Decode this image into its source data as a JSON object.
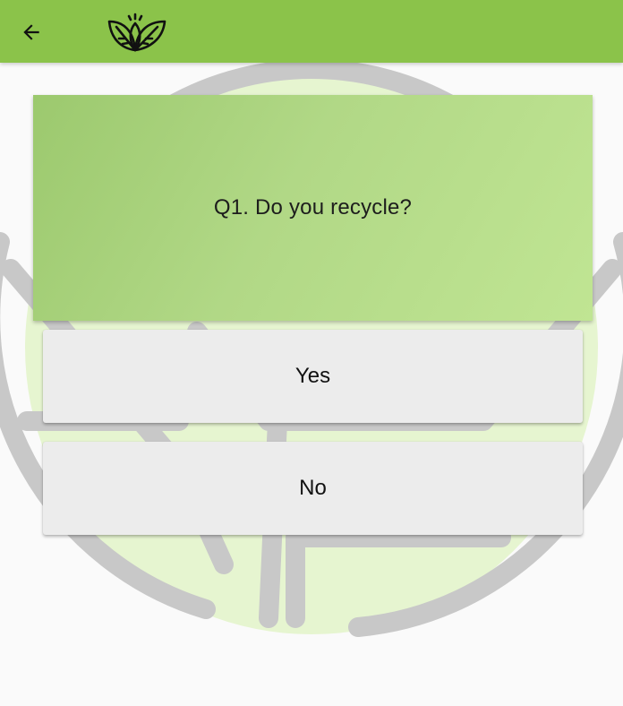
{
  "toolbar": {
    "back_icon": "arrow-left-icon",
    "logo_icon": "leaves-logo-icon",
    "background_color": "#8bc34a"
  },
  "background": {
    "icon": "recycle-globe-icon",
    "stroke_color": "#c8c8c8",
    "fill_color": "#e6f5d0"
  },
  "question": {
    "text": "Q1. Do you recycle?"
  },
  "answers": [
    {
      "label": "Yes"
    },
    {
      "label": "No"
    }
  ]
}
